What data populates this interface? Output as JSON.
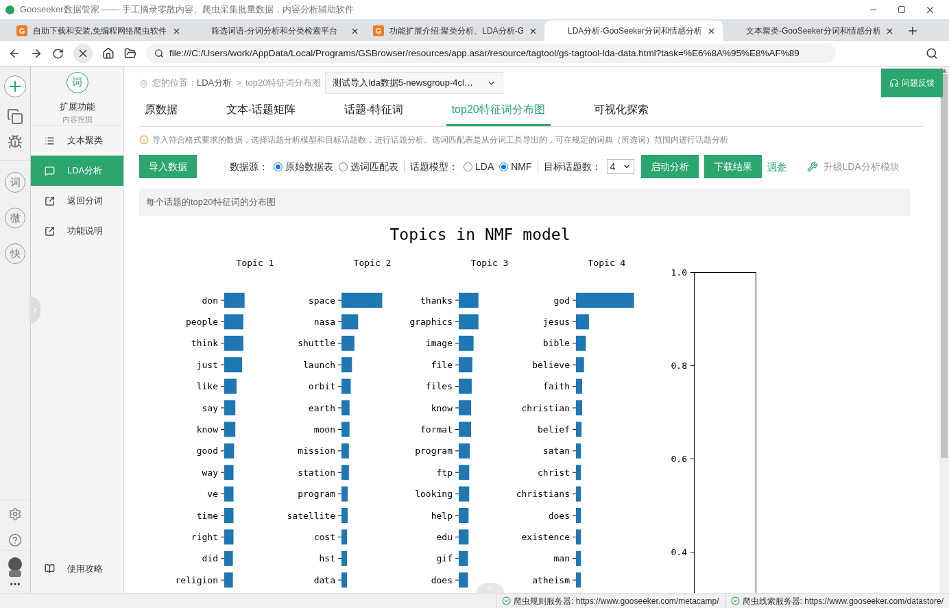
{
  "window": {
    "title": "Gooseeker数据管家 —— 手工摘录零散内容、爬虫采集批量数据，内容分析辅助软件"
  },
  "browser_tabs": [
    {
      "title": "自助下载和安装,免编程网络爬虫软件",
      "favicon": "G",
      "selected": false
    },
    {
      "title": "筛选词语-分词分析和分类检索平台",
      "selected": false
    },
    {
      "title": "功能扩展介绍:聚类分析、LDA分析-G",
      "favicon": "G",
      "selected": false
    },
    {
      "title": "LDA分析-GooSeeker分词和情感分析",
      "selected": true
    },
    {
      "title": "文本聚类-GooSeeker分词和情感分析",
      "selected": false
    }
  ],
  "address_bar": {
    "url": "file:///C:/Users/work/AppData/Local/Programs/GSBrowser/resources/app.asar/resource/tagtool/gs-tagtool-lda-data.html?task=%E6%8A%95%E8%AF%89"
  },
  "rail": {
    "badges": [
      "词",
      "微",
      "快"
    ]
  },
  "sidebar": {
    "badge": "词",
    "title": "扩展功能",
    "subtitle": "内容挖掘",
    "items": [
      {
        "label": "文本聚类",
        "selected": false
      },
      {
        "label": "LDA分析",
        "selected": true
      },
      {
        "label": "返回分词",
        "selected": false
      },
      {
        "label": "功能说明",
        "selected": false
      }
    ],
    "footer": "使用攻略"
  },
  "breadcrumb": {
    "prefix": "您的位置：",
    "parent": "LDA分析",
    "separator": ">",
    "current": "top20特征词分布图"
  },
  "dataset_select": {
    "value": "测试导入lda数据5-newsgroup-4cl…"
  },
  "feedback_button": "问题反馈",
  "tabs": [
    {
      "label": "原数据",
      "selected": false
    },
    {
      "label": "文本-话题矩阵",
      "selected": false
    },
    {
      "label": "话题-特征词",
      "selected": false
    },
    {
      "label": "top20特征词分布图",
      "selected": true
    },
    {
      "label": "可视化探索",
      "selected": false
    }
  ],
  "info": "导入符合格式要求的数据，选择话题分析模型和目标话题数，进行话题分析。选词匹配表是从分词工具导出的，可在规定的词典（所选词）范围内进行话题分析",
  "toolbar": {
    "import_button": "导入数据",
    "source_label": "数据源：",
    "sources": [
      {
        "label": "原始数据表",
        "selected": true
      },
      {
        "label": "选词匹配表",
        "selected": false
      }
    ],
    "model_label": "话题模型：",
    "models": [
      {
        "label": "LDA",
        "selected": false
      },
      {
        "label": "NMF",
        "selected": true
      }
    ],
    "count_label": "目标话题数：",
    "count": "4",
    "start_button": "启动分析",
    "download_button": "下载结果",
    "tune_link": "调参",
    "upgrade": "升级LDA分析模块"
  },
  "panel": {
    "title": "每个话题的top20特征词的分布图"
  },
  "chart": {
    "title": "Topics in NMF model",
    "axis_ticks": [
      "1.0",
      "0.8",
      "0.6",
      "0.4"
    ],
    "topics": [
      {
        "title": "Topic 1",
        "terms": [
          {
            "word": "don",
            "level": 0.33
          },
          {
            "word": "people",
            "level": 0.31
          },
          {
            "word": "think",
            "level": 0.31
          },
          {
            "word": "just",
            "level": 0.29
          },
          {
            "word": "like",
            "level": 0.2
          },
          {
            "word": "say",
            "level": 0.18
          },
          {
            "word": "know",
            "level": 0.18
          },
          {
            "word": "good",
            "level": 0.16
          },
          {
            "word": "way",
            "level": 0.15
          },
          {
            "word": "ve",
            "level": 0.15
          },
          {
            "word": "time",
            "level": 0.15
          },
          {
            "word": "right",
            "level": 0.15
          },
          {
            "word": "did",
            "level": 0.14
          },
          {
            "word": "religion",
            "level": 0.14
          }
        ]
      },
      {
        "title": "Topic 2",
        "terms": [
          {
            "word": "space",
            "level": 0.66
          },
          {
            "word": "nasa",
            "level": 0.27
          },
          {
            "word": "shuttle",
            "level": 0.21
          },
          {
            "word": "launch",
            "level": 0.17
          },
          {
            "word": "orbit",
            "level": 0.15
          },
          {
            "word": "earth",
            "level": 0.13
          },
          {
            "word": "moon",
            "level": 0.13
          },
          {
            "word": "mission",
            "level": 0.12
          },
          {
            "word": "station",
            "level": 0.12
          },
          {
            "word": "program",
            "level": 0.1
          },
          {
            "word": "satellite",
            "level": 0.1
          },
          {
            "word": "cost",
            "level": 0.09
          },
          {
            "word": "hst",
            "level": 0.09
          },
          {
            "word": "data",
            "level": 0.09
          }
        ]
      },
      {
        "title": "Topic 3",
        "terms": [
          {
            "word": "thanks",
            "level": 0.32
          },
          {
            "word": "graphics",
            "level": 0.32
          },
          {
            "word": "image",
            "level": 0.24
          },
          {
            "word": "file",
            "level": 0.22
          },
          {
            "word": "files",
            "level": 0.21
          },
          {
            "word": "know",
            "level": 0.2
          },
          {
            "word": "format",
            "level": 0.2
          },
          {
            "word": "program",
            "level": 0.18
          },
          {
            "word": "ftp",
            "level": 0.17
          },
          {
            "word": "looking",
            "level": 0.17
          },
          {
            "word": "help",
            "level": 0.16
          },
          {
            "word": "edu",
            "level": 0.16
          },
          {
            "word": "gif",
            "level": 0.15
          },
          {
            "word": "does",
            "level": 0.15
          }
        ]
      },
      {
        "title": "Topic 4",
        "terms": [
          {
            "word": "god",
            "level": 0.94
          },
          {
            "word": "jesus",
            "level": 0.21
          },
          {
            "word": "bible",
            "level": 0.16
          },
          {
            "word": "believe",
            "level": 0.13
          },
          {
            "word": "faith",
            "level": 0.1
          },
          {
            "word": "christian",
            "level": 0.1
          },
          {
            "word": "belief",
            "level": 0.09
          },
          {
            "word": "satan",
            "level": 0.08
          },
          {
            "word": "christ",
            "level": 0.08
          },
          {
            "word": "christians",
            "level": 0.08
          },
          {
            "word": "does",
            "level": 0.08
          },
          {
            "word": "existence",
            "level": 0.08
          },
          {
            "word": "man",
            "level": 0.08
          },
          {
            "word": "atheism",
            "level": 0.08
          }
        ]
      }
    ]
  },
  "status_bar": [
    {
      "label": "爬虫规则服务器:",
      "url": "https://www.gooseeker.com/metacamp/"
    },
    {
      "label": "爬虫线索服务器:",
      "url": "https://www.gooseeker.com/datastore/"
    }
  ]
}
